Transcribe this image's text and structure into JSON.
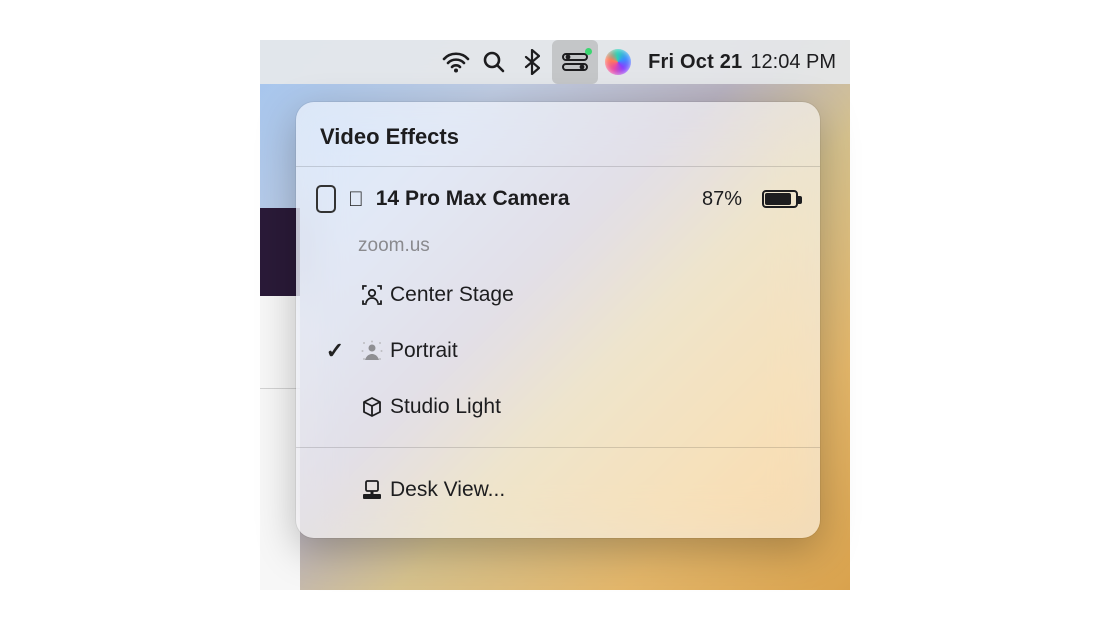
{
  "menubar": {
    "date": "Fri Oct 21",
    "time": "12:04 PM"
  },
  "panel": {
    "title": "Video Effects",
    "device": {
      "name": "14 Pro Max Camera",
      "battery_percent": "87%",
      "battery_fill": 87
    },
    "app_label": "zoom.us",
    "options": [
      {
        "id": "center-stage",
        "label": "Center Stage",
        "checked": false
      },
      {
        "id": "portrait",
        "label": "Portrait",
        "checked": true
      },
      {
        "id": "studio-light",
        "label": "Studio Light",
        "checked": false
      }
    ],
    "footer": {
      "desk_view_label": "Desk View..."
    }
  }
}
